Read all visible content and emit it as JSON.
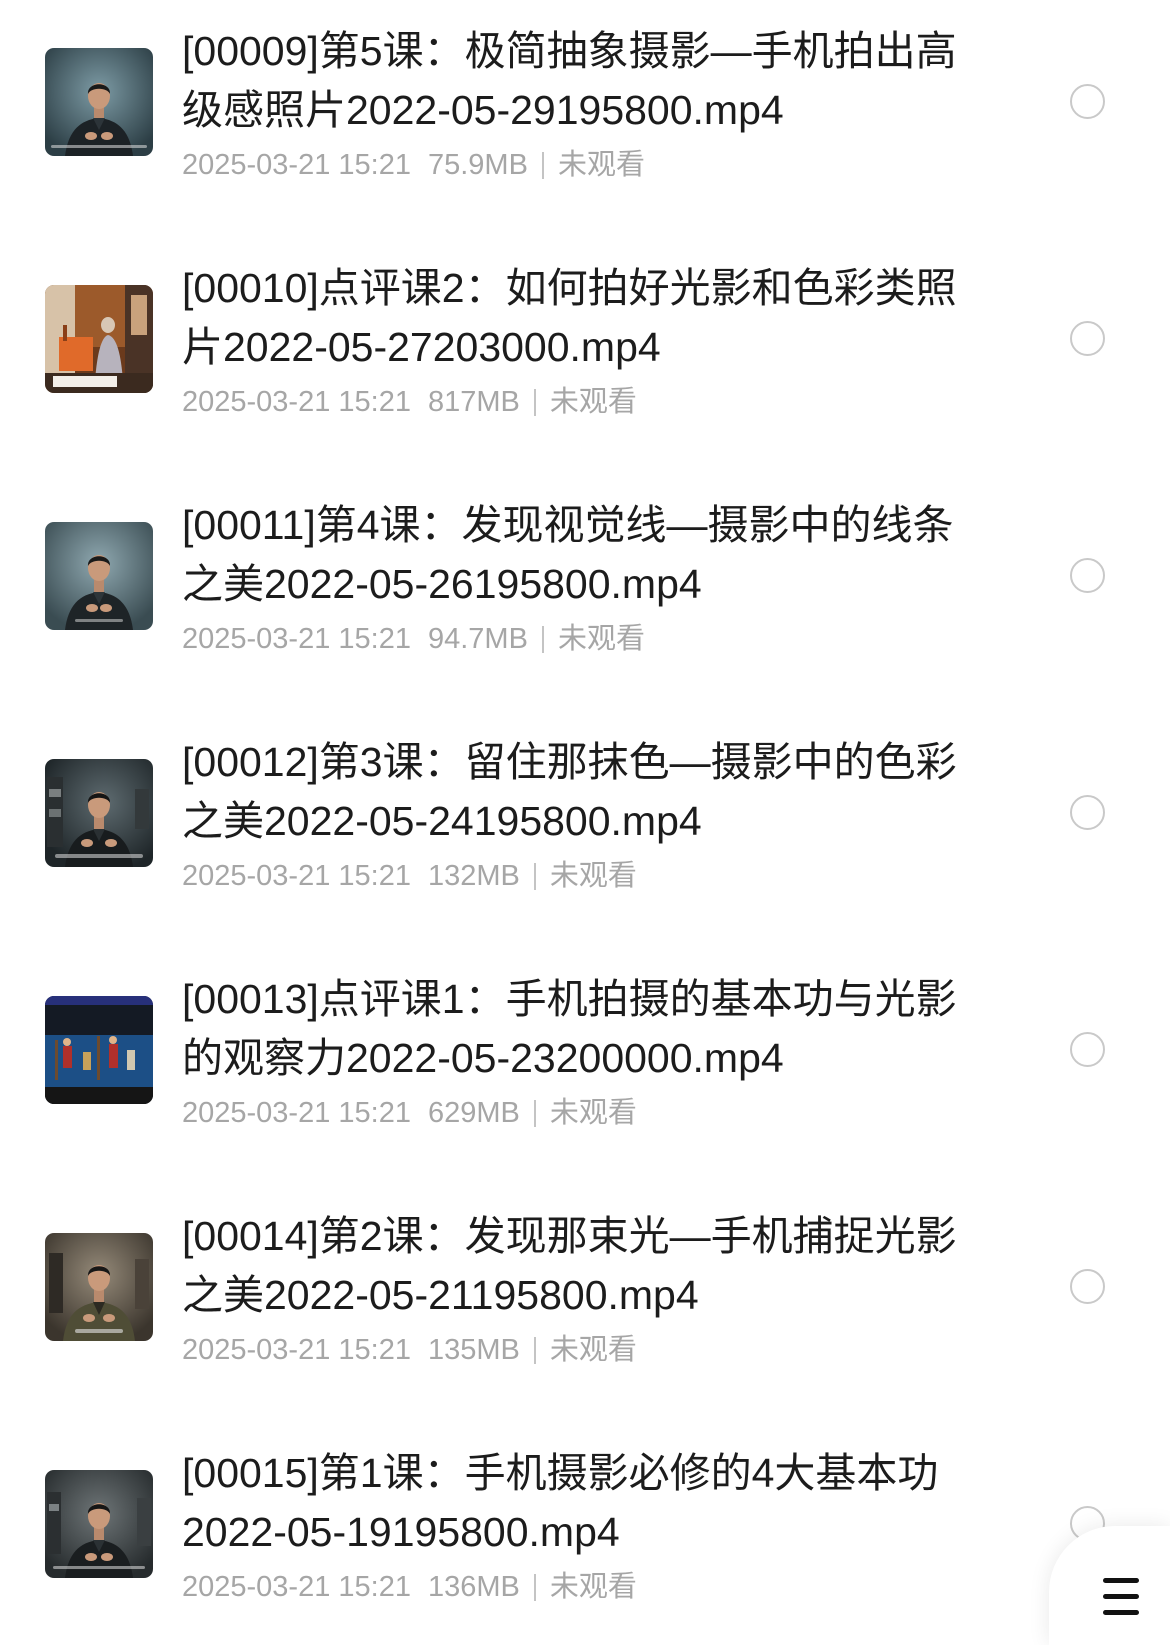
{
  "files": [
    {
      "title": "[00009]第5课：极简抽象摄影—手机拍出高级感照片2022-05-29195800.mp4",
      "date": "2025-03-21 15:21",
      "size": "75.9MB",
      "status": "未观看"
    },
    {
      "title": "[00010]点评课2：如何拍好光影和色彩类照片2022-05-27203000.mp4",
      "date": "2025-03-21 15:21",
      "size": "817MB",
      "status": "未观看"
    },
    {
      "title": "[00011]第4课：发现视觉线—摄影中的线条之美2022-05-26195800.mp4",
      "date": "2025-03-21 15:21",
      "size": "94.7MB",
      "status": "未观看"
    },
    {
      "title": "[00012]第3课：留住那抹色—摄影中的色彩之美2022-05-24195800.mp4",
      "date": "2025-03-21 15:21",
      "size": "132MB",
      "status": "未观看"
    },
    {
      "title": "[00013]点评课1：手机拍摄的基本功与光影的观察力2022-05-23200000.mp4",
      "date": "2025-03-21 15:21",
      "size": "629MB",
      "status": "未观看"
    },
    {
      "title": "[00014]第2课：发现那束光—手机捕捉光影之美2022-05-21195800.mp4",
      "date": "2025-03-21 15:21",
      "size": "135MB",
      "status": "未观看"
    },
    {
      "title": "[00015]第1课：手机摄影必修的4大基本功2022-05-19195800.mp4",
      "date": "2025-03-21 15:21",
      "size": "136MB",
      "status": "未观看"
    }
  ],
  "menu_button": {
    "icon": "menu-icon"
  },
  "colors": {
    "title": "#1c1c1c",
    "meta": "#a6a6a6",
    "divider": "#c4c4c4",
    "radio_border": "#c9c9c9",
    "background": "#ffffff"
  }
}
